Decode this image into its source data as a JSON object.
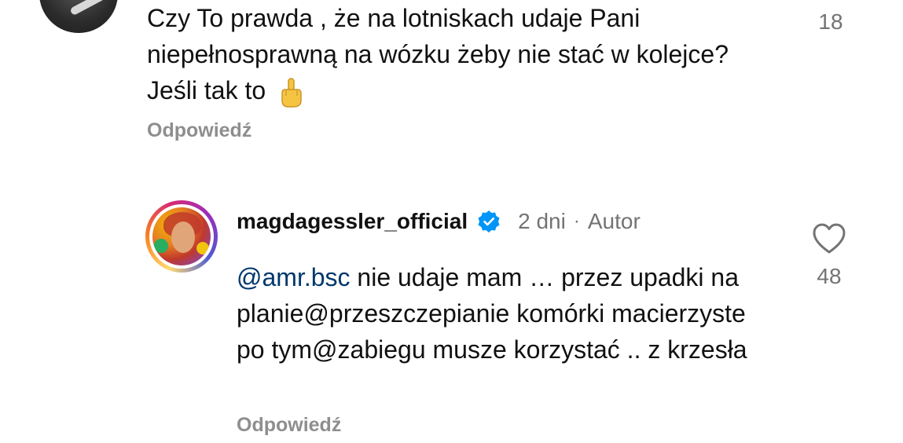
{
  "top_comment": {
    "text": "Czy To prawda , że na lotniskach udaje Pani niepełnosprawną na wózku żeby nie stać w kolejce? Jeśli tak to",
    "emoji_icon": "middle-finger-emoji",
    "likes": "18",
    "reply_label": "Odpowiedź"
  },
  "reply_comment": {
    "username": "magdagessler_official",
    "verified_icon": "verified-badge-icon",
    "time": "2 dni",
    "separator": "·",
    "author_label": "Autor",
    "mention": "@amr.bsc",
    "text": " nie udaje mam … przez upadki na planie@przeszczepianie komórki macierzyste po tym@zabiegu musze korzystać .. z krzesła",
    "like_icon": "heart-outline-icon",
    "likes": "48",
    "reply_label": "Odpowiedź"
  },
  "colors": {
    "text": "#111111",
    "muted": "#737373",
    "reply_link": "#8e8e8e",
    "mention": "#00376b",
    "verified_blue": "#0095f6"
  }
}
